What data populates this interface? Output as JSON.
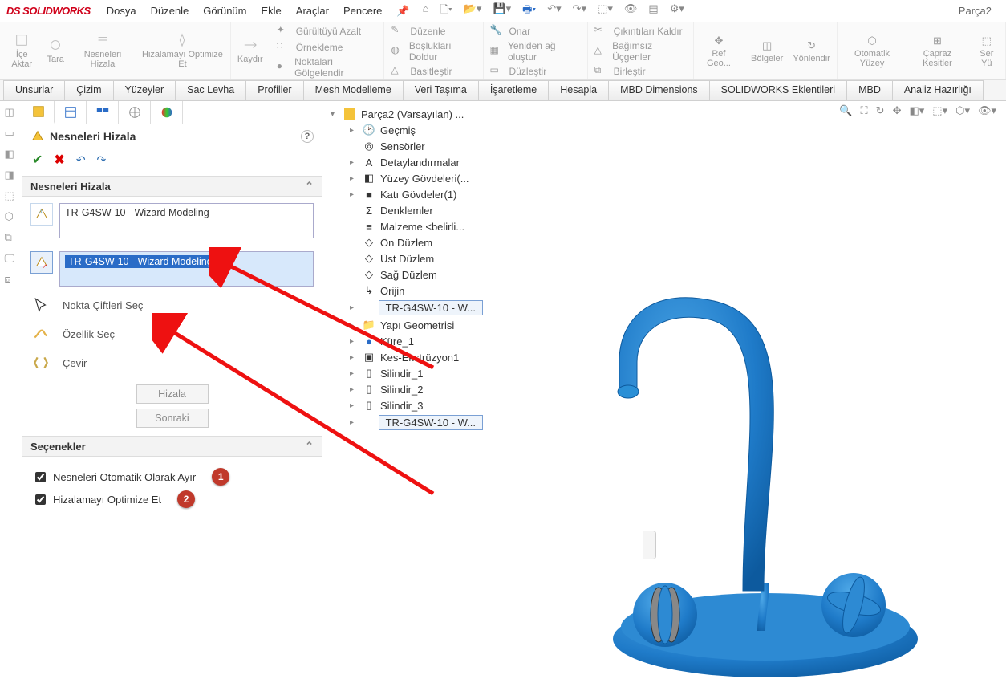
{
  "app": {
    "name": "SOLIDWORKS",
    "doc": "Parça2"
  },
  "menu": [
    "Dosya",
    "Düzenle",
    "Görünüm",
    "Ekle",
    "Araçlar",
    "Pencere"
  ],
  "ribbon": {
    "g1": [
      "İçe\nAktar",
      "Tara",
      "Nesneleri\nHizala",
      "Hizalamayı\nOptimize Et"
    ],
    "g2": {
      "big": "Kaydır",
      "rows": [
        "Gürültüyü Azalt",
        "Örnekleme",
        "Noktaları Gölgelendir"
      ]
    },
    "g3": [
      "Düzenle",
      "Boşlukları Doldur",
      "Basitleştir"
    ],
    "g4": [
      "Onar",
      "Yeniden ağ oluştur",
      "Düzleştir"
    ],
    "g5": [
      "Çıkıntıları Kaldır",
      "Bağımsız Üçgenler",
      "Birleştir"
    ],
    "g6": "Ref Geo...",
    "g7": [
      "Bölgeler",
      "Yönlendir"
    ],
    "g8": [
      "Otomatik\nYüzey",
      "Çapraz\nKesitler",
      "Ser\nYü"
    ]
  },
  "tabs": [
    "Unsurlar",
    "Çizim",
    "Yüzeyler",
    "Sac Levha",
    "Profiller",
    "Mesh Modelleme",
    "Veri Taşıma",
    "İşaretleme",
    "Hesapla",
    "MBD Dimensions",
    "SOLIDWORKS Eklentileri",
    "MBD",
    "Analiz Hazırlığı"
  ],
  "panel": {
    "title": "Nesneleri Hizala",
    "section": "Nesneleri Hizala",
    "sel1": "TR-G4SW-10 - Wizard Modeling",
    "sel2": "TR-G4SW-10 - Wizard Modeling2",
    "tools": [
      "Nokta Çiftleri Seç",
      "Özellik Seç",
      "Çevir"
    ],
    "btn_align": "Hizala",
    "btn_next": "Sonraki",
    "opts_title": "Seçenekler",
    "opt1": "Nesneleri Otomatik Olarak Ayır",
    "opt2": "Hizalamayı Optimize Et",
    "badge1": "1",
    "badge2": "2"
  },
  "tree": {
    "root": "Parça2 (Varsayılan) ...",
    "items": [
      "Geçmiş",
      "Sensörler",
      "Detaylandırmalar",
      "Yüzey Gövdeleri(...",
      "Katı Gövdeler(1)",
      "Denklemler",
      "Malzeme <belirli...",
      "Ön Düzlem",
      "Üst Düzlem",
      "Sağ Düzlem",
      "Orijin"
    ],
    "sel1": "TR-G4SW-10 - W...",
    "after": [
      "Yapı Geometrisi",
      "Küre_1",
      "Kes-Ekstrüzyon1",
      "Silindir_1",
      "Silindir_2",
      "Silindir_3"
    ],
    "sel2": "TR-G4SW-10 - W..."
  }
}
